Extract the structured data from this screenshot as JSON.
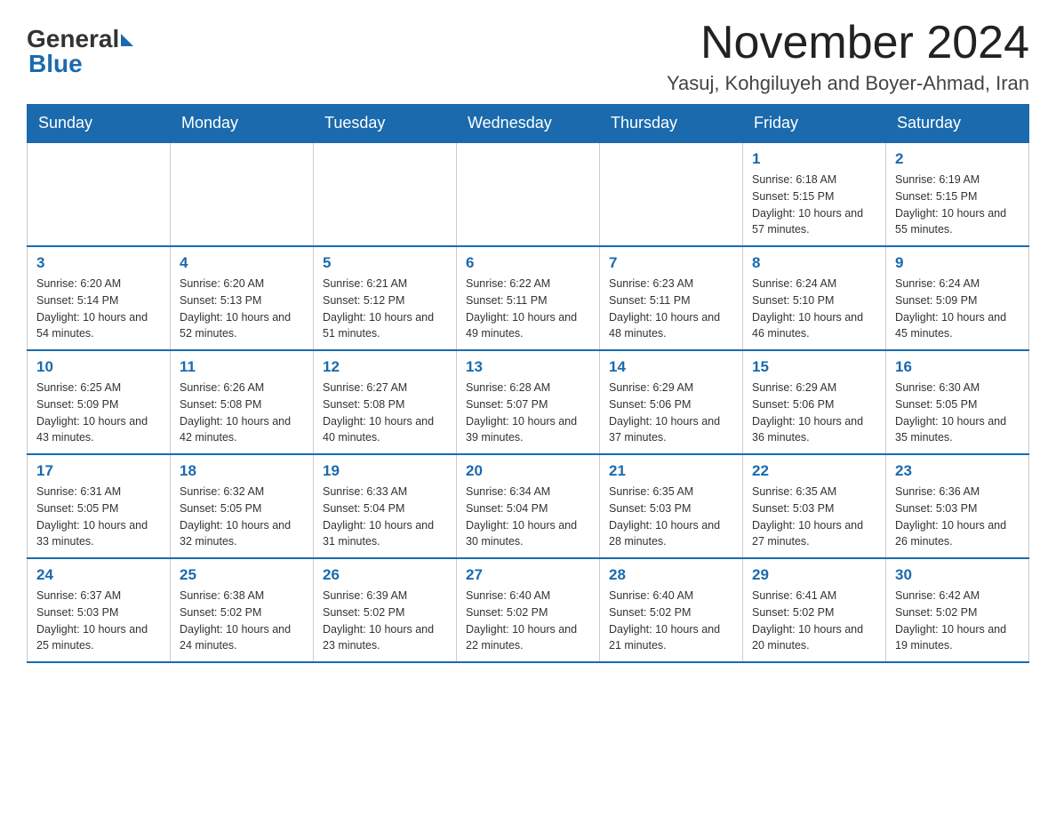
{
  "header": {
    "logo_general": "General",
    "logo_blue": "Blue",
    "title": "November 2024",
    "subtitle": "Yasuj, Kohgiluyeh and Boyer-Ahmad, Iran"
  },
  "days_of_week": [
    "Sunday",
    "Monday",
    "Tuesday",
    "Wednesday",
    "Thursday",
    "Friday",
    "Saturday"
  ],
  "weeks": [
    {
      "days": [
        {
          "number": "",
          "info": ""
        },
        {
          "number": "",
          "info": ""
        },
        {
          "number": "",
          "info": ""
        },
        {
          "number": "",
          "info": ""
        },
        {
          "number": "",
          "info": ""
        },
        {
          "number": "1",
          "info": "Sunrise: 6:18 AM\nSunset: 5:15 PM\nDaylight: 10 hours and 57 minutes."
        },
        {
          "number": "2",
          "info": "Sunrise: 6:19 AM\nSunset: 5:15 PM\nDaylight: 10 hours and 55 minutes."
        }
      ]
    },
    {
      "days": [
        {
          "number": "3",
          "info": "Sunrise: 6:20 AM\nSunset: 5:14 PM\nDaylight: 10 hours and 54 minutes."
        },
        {
          "number": "4",
          "info": "Sunrise: 6:20 AM\nSunset: 5:13 PM\nDaylight: 10 hours and 52 minutes."
        },
        {
          "number": "5",
          "info": "Sunrise: 6:21 AM\nSunset: 5:12 PM\nDaylight: 10 hours and 51 minutes."
        },
        {
          "number": "6",
          "info": "Sunrise: 6:22 AM\nSunset: 5:11 PM\nDaylight: 10 hours and 49 minutes."
        },
        {
          "number": "7",
          "info": "Sunrise: 6:23 AM\nSunset: 5:11 PM\nDaylight: 10 hours and 48 minutes."
        },
        {
          "number": "8",
          "info": "Sunrise: 6:24 AM\nSunset: 5:10 PM\nDaylight: 10 hours and 46 minutes."
        },
        {
          "number": "9",
          "info": "Sunrise: 6:24 AM\nSunset: 5:09 PM\nDaylight: 10 hours and 45 minutes."
        }
      ]
    },
    {
      "days": [
        {
          "number": "10",
          "info": "Sunrise: 6:25 AM\nSunset: 5:09 PM\nDaylight: 10 hours and 43 minutes."
        },
        {
          "number": "11",
          "info": "Sunrise: 6:26 AM\nSunset: 5:08 PM\nDaylight: 10 hours and 42 minutes."
        },
        {
          "number": "12",
          "info": "Sunrise: 6:27 AM\nSunset: 5:08 PM\nDaylight: 10 hours and 40 minutes."
        },
        {
          "number": "13",
          "info": "Sunrise: 6:28 AM\nSunset: 5:07 PM\nDaylight: 10 hours and 39 minutes."
        },
        {
          "number": "14",
          "info": "Sunrise: 6:29 AM\nSunset: 5:06 PM\nDaylight: 10 hours and 37 minutes."
        },
        {
          "number": "15",
          "info": "Sunrise: 6:29 AM\nSunset: 5:06 PM\nDaylight: 10 hours and 36 minutes."
        },
        {
          "number": "16",
          "info": "Sunrise: 6:30 AM\nSunset: 5:05 PM\nDaylight: 10 hours and 35 minutes."
        }
      ]
    },
    {
      "days": [
        {
          "number": "17",
          "info": "Sunrise: 6:31 AM\nSunset: 5:05 PM\nDaylight: 10 hours and 33 minutes."
        },
        {
          "number": "18",
          "info": "Sunrise: 6:32 AM\nSunset: 5:05 PM\nDaylight: 10 hours and 32 minutes."
        },
        {
          "number": "19",
          "info": "Sunrise: 6:33 AM\nSunset: 5:04 PM\nDaylight: 10 hours and 31 minutes."
        },
        {
          "number": "20",
          "info": "Sunrise: 6:34 AM\nSunset: 5:04 PM\nDaylight: 10 hours and 30 minutes."
        },
        {
          "number": "21",
          "info": "Sunrise: 6:35 AM\nSunset: 5:03 PM\nDaylight: 10 hours and 28 minutes."
        },
        {
          "number": "22",
          "info": "Sunrise: 6:35 AM\nSunset: 5:03 PM\nDaylight: 10 hours and 27 minutes."
        },
        {
          "number": "23",
          "info": "Sunrise: 6:36 AM\nSunset: 5:03 PM\nDaylight: 10 hours and 26 minutes."
        }
      ]
    },
    {
      "days": [
        {
          "number": "24",
          "info": "Sunrise: 6:37 AM\nSunset: 5:03 PM\nDaylight: 10 hours and 25 minutes."
        },
        {
          "number": "25",
          "info": "Sunrise: 6:38 AM\nSunset: 5:02 PM\nDaylight: 10 hours and 24 minutes."
        },
        {
          "number": "26",
          "info": "Sunrise: 6:39 AM\nSunset: 5:02 PM\nDaylight: 10 hours and 23 minutes."
        },
        {
          "number": "27",
          "info": "Sunrise: 6:40 AM\nSunset: 5:02 PM\nDaylight: 10 hours and 22 minutes."
        },
        {
          "number": "28",
          "info": "Sunrise: 6:40 AM\nSunset: 5:02 PM\nDaylight: 10 hours and 21 minutes."
        },
        {
          "number": "29",
          "info": "Sunrise: 6:41 AM\nSunset: 5:02 PM\nDaylight: 10 hours and 20 minutes."
        },
        {
          "number": "30",
          "info": "Sunrise: 6:42 AM\nSunset: 5:02 PM\nDaylight: 10 hours and 19 minutes."
        }
      ]
    }
  ]
}
